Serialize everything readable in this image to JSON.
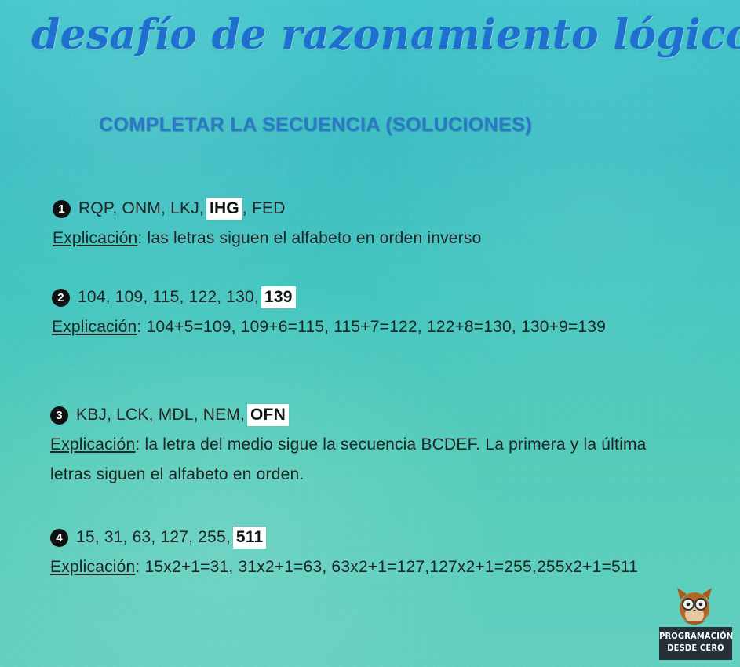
{
  "page": {
    "main_title": "desafío de razonamiento lógico",
    "subtitle": "COMPLETAR LA SECUENCIA  (SOLUCIONES)"
  },
  "items": [
    {
      "number": "1",
      "sequence_before_answer": "RQP, ONM, LKJ,",
      "answer": "IHG",
      "sequence_after_answer": ", FED",
      "explanation_label": "Explicación",
      "explanation_text": ": las letras siguen el alfabeto en orden inverso"
    },
    {
      "number": "2",
      "sequence_before_answer": "104, 109, 115, 122, 130,",
      "answer": "139",
      "sequence_after_answer": "",
      "explanation_label": "Explicación",
      "explanation_text": ": 104+5=109,  109+6=115,  115+7=122,  122+8=130, 130+9=139"
    },
    {
      "number": "3",
      "sequence_before_answer": "KBJ, LCK, MDL, NEM,",
      "answer": "OFN",
      "sequence_after_answer": "",
      "explanation_label": "Explicación",
      "explanation_text": ": la letra del medio sigue la secuencia BCDEF. La primera y la última letras siguen el alfabeto en orden."
    },
    {
      "number": "4",
      "sequence_before_answer": "15, 31, 63, 127, 255,",
      "answer": "511",
      "sequence_after_answer": "",
      "explanation_label": "Explicación",
      "explanation_text": ": 15x2+1=31,  31x2+1=63, 63x2+1=127,127x2+1=255,255x2+1=511"
    }
  ],
  "logo": {
    "line_1": "PROGRAMACIÓN",
    "line_2": "DESDE CERO",
    "icon": "owl-fox-mascot-icon"
  },
  "colors": {
    "background_top": "#43c6cc",
    "background_bottom": "#63cfbf",
    "title": "#1f6fd1",
    "subtitle": "#2b79c6",
    "text": "#202424",
    "answer_highlight": "#ffffff",
    "logo_bg": "#273036"
  }
}
